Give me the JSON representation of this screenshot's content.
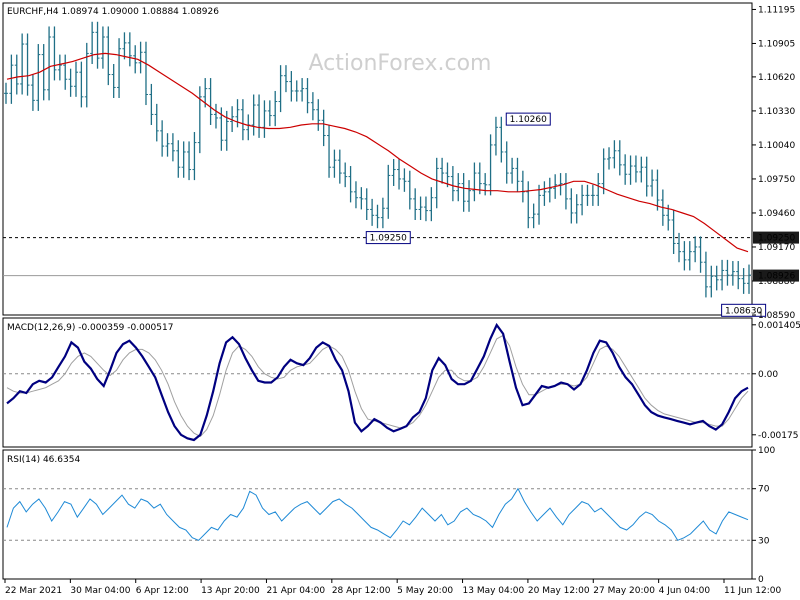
{
  "chart_data": [
    {
      "type": "ohlc",
      "title": "EURCHF,H4  1.08974 1.09000 1.08884 1.08926",
      "watermark": "ActionForex.com",
      "ylim": [
        1.0859,
        1.1125
      ],
      "y_ticks": [
        1.11195,
        1.10905,
        1.1062,
        1.1033,
        1.1004,
        1.0975,
        1.0946,
        1.0917,
        1.0888,
        1.0859
      ],
      "y_tick_labels": [
        "1.11195",
        "1.10905",
        "1.10620",
        "1.10330",
        "1.10040",
        "1.09750",
        "1.09460",
        "1.09170",
        "1.08880",
        "1.08590"
      ],
      "current_price": 1.08926,
      "current_price_label": "1.08926",
      "hline": 1.0925,
      "hline_label": "1.09250",
      "annotations": [
        {
          "text": "1.10260",
          "x": 97,
          "y": 1.1026
        },
        {
          "text": "1.09250",
          "x": 71,
          "y": 1.0925
        },
        {
          "text": "1.08630",
          "x": 137,
          "y": 1.0863
        }
      ],
      "series_close": [
        1.1048,
        1.1072,
        1.1056,
        1.109,
        1.1055,
        1.1042,
        1.1081,
        1.1051,
        1.1096,
        1.1068,
        1.1072,
        1.106,
        1.1054,
        1.1066,
        1.1045,
        1.1082,
        1.11,
        1.1078,
        1.1096,
        1.1064,
        1.1053,
        1.1086,
        1.1091,
        1.108,
        1.1074,
        1.1083,
        1.1047,
        1.103,
        1.1016,
        1.1003,
        1.1005,
        1.0999,
        1.0985,
        1.0998,
        1.0983,
        1.1006,
        1.1045,
        1.1052,
        1.103,
        1.1027,
        1.1008,
        1.1024,
        1.1028,
        1.1034,
        1.1017,
        1.1021,
        1.1038,
        1.1019,
        1.1033,
        1.1029,
        1.1041,
        1.1063,
        1.1058,
        1.105,
        1.105,
        1.1052,
        1.104,
        1.1034,
        1.1025,
        1.1012,
        1.0985,
        1.0991,
        1.098,
        1.0977,
        1.0964,
        1.0959,
        1.0958,
        1.0949,
        1.0944,
        1.0942,
        1.095,
        1.0978,
        1.0983,
        1.0975,
        1.0973,
        1.0958,
        1.0949,
        1.0951,
        1.0948,
        1.0959,
        1.0984,
        1.098,
        1.0977,
        1.0965,
        1.0971,
        1.0956,
        1.0965,
        1.098,
        1.0971,
        1.097,
        1.1004,
        1.1019,
        1.0998,
        1.098,
        1.0984,
        1.0973,
        1.0964,
        1.0942,
        1.0945,
        1.0961,
        1.0964,
        1.0967,
        1.097,
        1.0971,
        1.0958,
        1.0946,
        1.0953,
        1.0961,
        1.0961,
        1.0961,
        1.0971,
        1.0992,
        1.0993,
        1.0999,
        1.0987,
        1.0979,
        1.0986,
        1.0981,
        1.0985,
        1.0969,
        1.0974,
        1.0957,
        1.0944,
        1.094,
        1.092,
        1.0913,
        1.0906,
        1.0913,
        1.0917,
        1.0904,
        1.0883,
        1.0892,
        1.0889,
        1.0897,
        1.0893,
        1.0896,
        1.089,
        1.0886,
        1.0893
      ],
      "series_ma": [
        1.106,
        1.1062,
        1.1063,
        1.1066,
        1.1071,
        1.1073,
        1.1075,
        1.1078,
        1.1081,
        1.1082,
        1.1081,
        1.1079,
        1.1077,
        1.1072,
        1.1066,
        1.106,
        1.1054,
        1.1048,
        1.1041,
        1.1034,
        1.1028,
        1.1024,
        1.1021,
        1.1019,
        1.1018,
        1.1018,
        1.1019,
        1.1021,
        1.1022,
        1.1022,
        1.102,
        1.1018,
        1.1015,
        1.1011,
        1.1005,
        1.0999,
        1.0992,
        1.0986,
        1.098,
        1.0975,
        1.0972,
        1.0969,
        1.0967,
        1.0966,
        1.0965,
        1.0965,
        1.0964,
        1.0964,
        1.0965,
        1.0966,
        1.0968,
        1.097,
        1.0973,
        1.0973,
        1.097,
        1.0966,
        1.0962,
        1.0959,
        1.0956,
        1.0954,
        1.0951,
        1.0949,
        1.0946,
        1.0943,
        1.0937,
        1.093,
        1.0923,
        1.0916,
        1.0913
      ]
    },
    {
      "type": "line",
      "title": "MACD(12,26,9) -0.000359 -0.000517",
      "ylim": [
        -0.0021,
        0.0016
      ],
      "y_ticks": [
        0.001405,
        0.0,
        -0.00175
      ],
      "y_tick_labels": [
        "0.001405",
        "0.00",
        "-0.00175"
      ],
      "zero_label": "0.00",
      "series": [
        {
          "values": [
            -0.00085,
            -0.0007,
            -0.0005,
            -0.00055,
            -0.0003,
            -0.0002,
            -0.00025,
            -0.0001,
            0.0002,
            0.0005,
            0.0009,
            0.00075,
            0.00035,
            0.00015,
            -0.00015,
            -0.00035,
            0.0001,
            0.0006,
            0.00085,
            0.00095,
            0.00075,
            0.0005,
            0.0002,
            -0.0001,
            -0.0006,
            -0.0011,
            -0.0015,
            -0.00175,
            -0.00185,
            -0.0019,
            -0.00175,
            -0.0012,
            -0.0005,
            0.0003,
            0.0009,
            0.00105,
            0.00085,
            0.00045,
            0.0001,
            -0.0002,
            -0.00025,
            -0.00025,
            -0.0001,
            0.0002,
            0.0004,
            0.0003,
            0.00025,
            0.00045,
            0.00075,
            0.0009,
            0.0008,
            0.0004,
            0.0001,
            -0.0005,
            -0.0014,
            -0.00165,
            -0.0015,
            -0.0013,
            -0.0014,
            -0.00155,
            -0.00165,
            -0.00158,
            -0.0015,
            -0.00125,
            -0.0011,
            -0.0007,
            0.0001,
            0.00045,
            0.00025,
            -0.00015,
            -0.0003,
            -0.0003,
            -0.0002,
            0.00015,
            0.0005,
            0.001,
            0.0014,
            0.00115,
            0.00035,
            -0.0004,
            -0.0009,
            -0.00085,
            -0.0006,
            -0.00035,
            -0.0004,
            -0.00035,
            -0.00025,
            -0.0003,
            -0.00045,
            -0.0003,
            0.0001,
            0.0006,
            0.00095,
            0.0009,
            0.0006,
            0.0002,
            -0.0001,
            -0.0003,
            -0.0006,
            -0.0009,
            -0.0011,
            -0.0012,
            -0.00125,
            -0.0013,
            -0.00135,
            -0.0014,
            -0.00145,
            -0.0014,
            -0.00135,
            -0.0015,
            -0.0016,
            -0.00145,
            -0.0011,
            -0.0007,
            -0.0005,
            -0.0004
          ],
          "color": "#000080"
        },
        {
          "values": [
            -0.0004,
            -0.0005,
            -0.00055,
            -0.00055,
            -0.0005,
            -0.00045,
            -0.0004,
            -0.0003,
            -0.0002,
            0.0,
            0.0003,
            0.0005,
            0.0006,
            0.0005,
            0.0003,
            0.0001,
            -5e-05,
            0.0001,
            0.0004,
            0.0006,
            0.0007,
            0.0007,
            0.0006,
            0.0004,
            0.0001,
            -0.0003,
            -0.0008,
            -0.0012,
            -0.0015,
            -0.0017,
            -0.0018,
            -0.0016,
            -0.0012,
            -0.0006,
            0.0001,
            0.0006,
            0.0008,
            0.0007,
            0.0005,
            0.0002,
            0.0,
            -0.0001,
            -0.00015,
            -0.0001,
            0.0001,
            0.0002,
            0.00025,
            0.0003,
            0.0005,
            0.0007,
            0.0008,
            0.0007,
            0.0005,
            0.0001,
            -0.0005,
            -0.001,
            -0.0013,
            -0.00135,
            -0.0014,
            -0.00145,
            -0.0015,
            -0.00155,
            -0.0015,
            -0.0014,
            -0.0012,
            -0.0009,
            -0.0005,
            -0.0001,
            0.0001,
            0.0001,
            -0.0001,
            -0.0002,
            -0.0002,
            -0.0001,
            0.0002,
            0.0006,
            0.001,
            0.0011,
            0.0008,
            0.0002,
            -0.0003,
            -0.0006,
            -0.0006,
            -0.0005,
            -0.0004,
            -0.00035,
            -0.0003,
            -0.0003,
            -0.00035,
            -0.0003,
            -0.0001,
            0.0003,
            0.0007,
            0.0008,
            0.0007,
            0.0005,
            0.0002,
            -0.0001,
            -0.0004,
            -0.0007,
            -0.0009,
            -0.00105,
            -0.00115,
            -0.0012,
            -0.00125,
            -0.0013,
            -0.00135,
            -0.0014,
            -0.0014,
            -0.00145,
            -0.0015,
            -0.0015,
            -0.0013,
            -0.001,
            -0.0007,
            -0.0005
          ],
          "color": "#a0a0a0"
        }
      ]
    },
    {
      "type": "line",
      "title": "RSI(14) 46.6354",
      "ylim": [
        0,
        100
      ],
      "y_ticks": [
        100,
        70,
        30,
        0
      ],
      "y_tick_labels": [
        "100",
        "70",
        "30",
        "0"
      ],
      "levels": [
        70,
        30
      ],
      "series": [
        {
          "values": [
            40,
            55,
            60,
            52,
            58,
            62,
            55,
            45,
            52,
            60,
            58,
            48,
            55,
            62,
            58,
            50,
            55,
            60,
            65,
            58,
            55,
            62,
            60,
            55,
            58,
            50,
            45,
            40,
            38,
            32,
            30,
            35,
            40,
            38,
            45,
            50,
            48,
            55,
            68,
            65,
            55,
            50,
            52,
            45,
            50,
            55,
            58,
            60,
            55,
            50,
            55,
            60,
            62,
            58,
            55,
            50,
            45,
            40,
            38,
            35,
            32,
            38,
            45,
            42,
            48,
            55,
            50,
            45,
            50,
            42,
            45,
            52,
            55,
            50,
            48,
            45,
            40,
            50,
            58,
            62,
            70,
            60,
            52,
            45,
            50,
            55,
            48,
            42,
            50,
            55,
            60,
            58,
            52,
            55,
            50,
            45,
            40,
            38,
            42,
            48,
            52,
            50,
            45,
            42,
            38,
            30,
            32,
            35,
            40,
            45,
            38,
            35,
            45,
            52,
            50,
            48,
            46
          ],
          "color": "#1f8ad6"
        }
      ]
    }
  ],
  "x_axis": {
    "labels": [
      "22 Mar 2021",
      "30 Mar 04:00",
      "6 Apr 12:00",
      "13 Apr 20:00",
      "21 Apr 04:00",
      "28 Apr 12:00",
      "5 May 20:00",
      "13 May 04:00",
      "20 May 12:00",
      "27 May 20:00",
      "4 Jun 04:00",
      "11 Jun 12:00"
    ]
  },
  "colors": {
    "bars": "#1f6f86",
    "ma": "#cc0000",
    "macd": "#000080",
    "signal": "#a0a0a0",
    "rsi": "#1f8ad6"
  }
}
